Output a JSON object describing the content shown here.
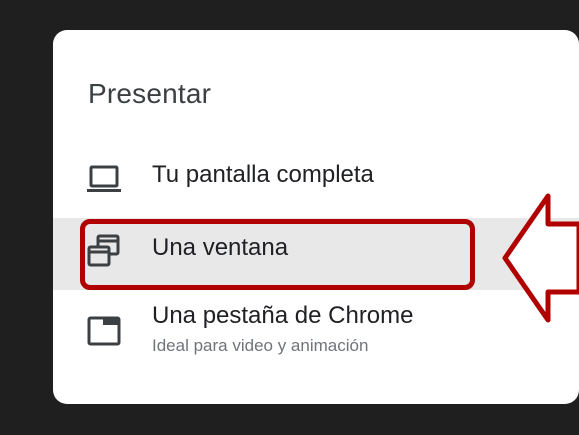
{
  "dialog": {
    "title": "Presentar",
    "options": [
      {
        "icon": "laptop-icon",
        "label": "Tu pantalla completa"
      },
      {
        "icon": "window-icon",
        "label": "Una ventana"
      },
      {
        "icon": "tab-icon",
        "label": "Una pestaña de Chrome",
        "sublabel": "Ideal para video y animación"
      }
    ]
  },
  "annotation": {
    "highlight_color": "#b00000"
  }
}
